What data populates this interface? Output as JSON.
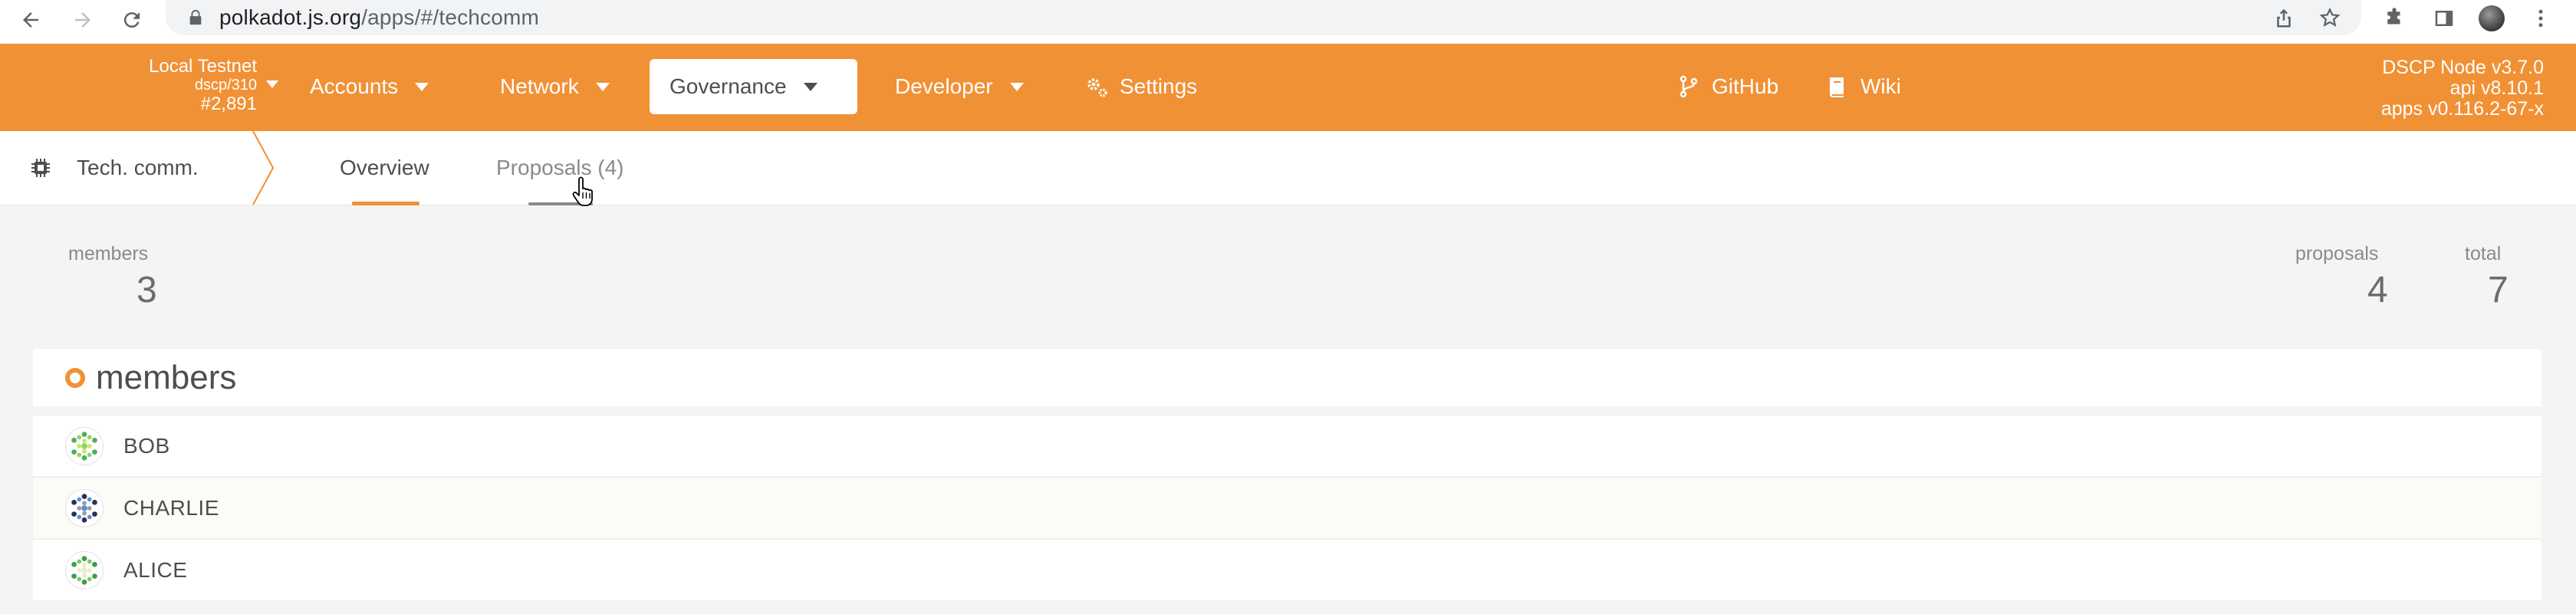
{
  "browser": {
    "url_host": "polkadot.js.org",
    "url_path": "/apps/#/techcomm"
  },
  "header": {
    "chain_name": "Local Testnet",
    "chain_runtime": "dscp/310",
    "block_number": "#2,891",
    "menu": [
      {
        "label": "Accounts",
        "icon": "chevron-down-icon"
      },
      {
        "label": "Network",
        "icon": "chevron-down-icon"
      },
      {
        "label": "Governance",
        "icon": "chevron-down-icon"
      },
      {
        "label": "Developer",
        "icon": "chevron-down-icon"
      },
      {
        "label": "Settings",
        "icon": "gears-icon"
      },
      {
        "label": "GitHub",
        "icon": "code-branch-icon"
      },
      {
        "label": "Wiki",
        "icon": "book-icon"
      }
    ],
    "node_version": "DSCP Node v3.7.0",
    "api_version": "api v8.10.1",
    "apps_version": "apps v0.116.2-67-x"
  },
  "section": {
    "title": "Tech. comm.",
    "tabs": [
      {
        "label": "Overview",
        "active": true
      },
      {
        "label": "Proposals (4)",
        "active": false
      }
    ]
  },
  "summary": {
    "members_label": "members",
    "members_value": "3",
    "proposals_label": "proposals",
    "proposals_value": "4",
    "total_label": "total",
    "total_value": "7"
  },
  "members": {
    "title": "members",
    "rows": [
      {
        "name": "BOB"
      },
      {
        "name": "CHARLIE"
      },
      {
        "name": "ALICE"
      }
    ]
  },
  "colors": {
    "accent": "#f19135",
    "background": "#f5f4f3"
  }
}
